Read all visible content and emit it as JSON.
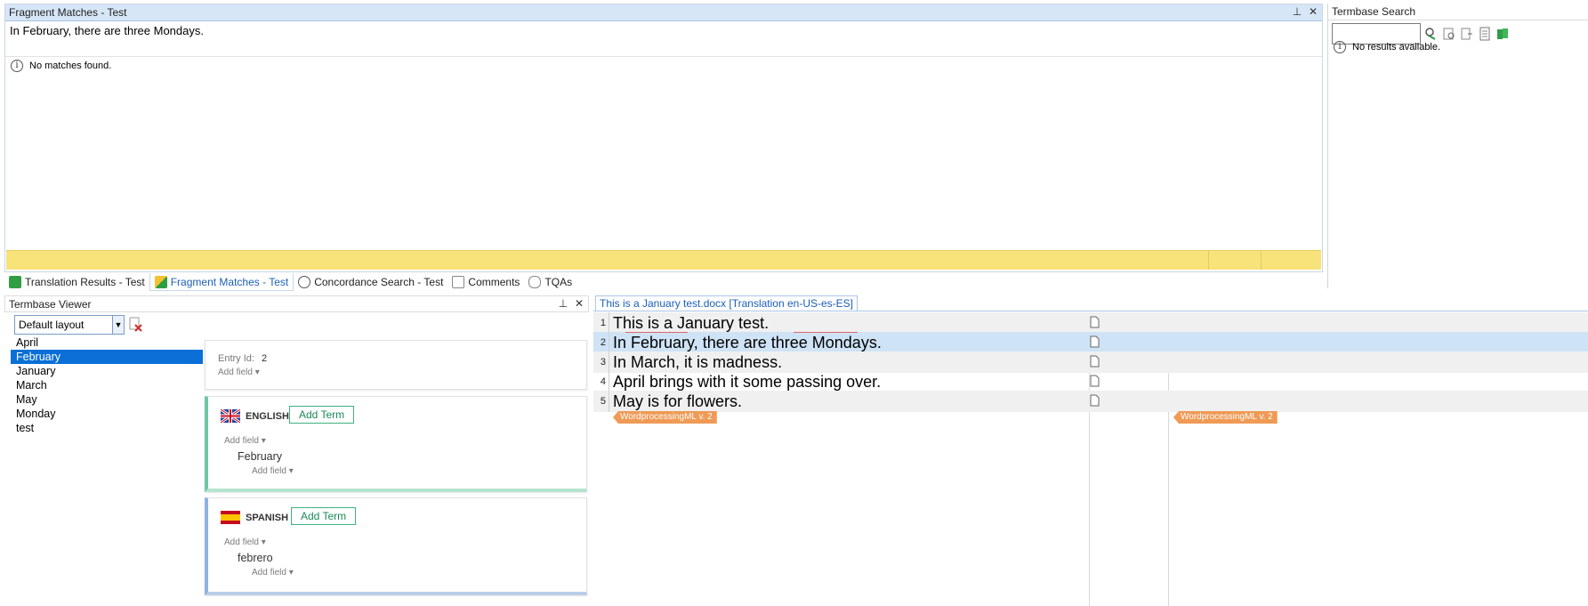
{
  "fragment_panel": {
    "title": "Fragment Matches - Test",
    "source_text": "In February, there are three Mondays.",
    "no_matches": "No matches found."
  },
  "termbase_search": {
    "title": "Termbase Search",
    "search_value": "",
    "no_results": "No results available."
  },
  "tabs": [
    {
      "label": "Translation Results - Test"
    },
    {
      "label": "Fragment Matches - Test"
    },
    {
      "label": "Concordance Search - Test"
    },
    {
      "label": "Comments"
    },
    {
      "label": "TQAs"
    }
  ],
  "termbase_viewer": {
    "title": "Termbase Viewer",
    "layout_value": "Default layout",
    "terms": [
      "April",
      "February",
      "January",
      "March",
      "May",
      "Monday",
      "test"
    ],
    "selected_index": 1,
    "entry": {
      "id_label": "Entry Id:",
      "id_value": "2",
      "add_field": "Add field ▾"
    },
    "english": {
      "lang": "ENGLISH",
      "add_term": "Add Term",
      "add_field": "Add field ▾",
      "term": "February",
      "term_add_field": "Add field ▾"
    },
    "spanish": {
      "lang": "SPANISH",
      "add_term": "Add Term",
      "add_field": "Add field ▾",
      "term": "febrero",
      "term_add_field": "Add field ▾"
    }
  },
  "editor": {
    "doc_tab": "This is a January test.docx [Translation en-US-es-ES]",
    "segments": [
      {
        "num": "1",
        "source": "This is a January test."
      },
      {
        "num": "2",
        "source": "In February, there are three Mondays."
      },
      {
        "num": "3",
        "source": "In March, it is madness."
      },
      {
        "num": "4",
        "source": "April brings with it some passing over."
      },
      {
        "num": "5",
        "source": "May is for flowers."
      }
    ],
    "tag_source": "WordprocessingML v. 2",
    "tag_target": "WordprocessingML v. 2"
  },
  "colors": {
    "accent": "#1c5fb8",
    "selection": "#0a6fd6",
    "yellow_bar": "#f8e27a",
    "tag": "#ef9a55"
  }
}
